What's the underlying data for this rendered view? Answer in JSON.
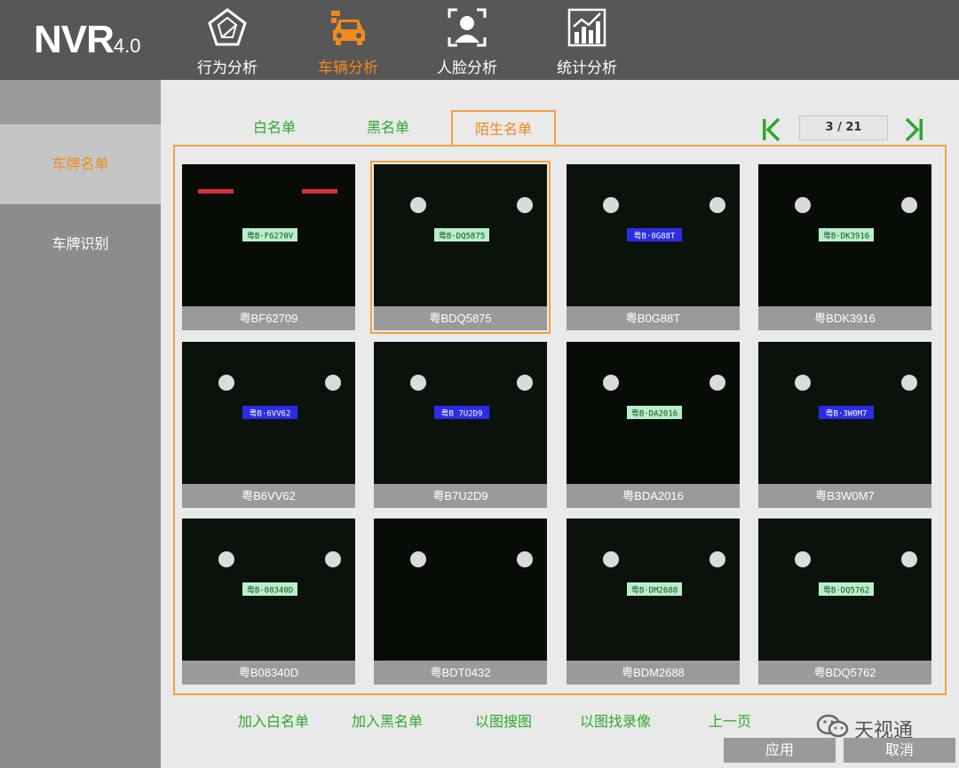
{
  "app": {
    "name": "NVR",
    "version": "4.0"
  },
  "nav": [
    {
      "label": "行为分析",
      "icon": "pentagon-analysis-icon",
      "active": false
    },
    {
      "label": "车辆分析",
      "icon": "car-icon",
      "active": true
    },
    {
      "label": "人脸分析",
      "icon": "face-scan-icon",
      "active": false
    },
    {
      "label": "统计分析",
      "icon": "bar-chart-icon",
      "active": false
    }
  ],
  "sidebar": [
    {
      "label": "车牌名单",
      "active": true
    },
    {
      "label": "车牌识别",
      "active": false
    }
  ],
  "tabs": [
    {
      "label": "白名单",
      "active": false
    },
    {
      "label": "黑名单",
      "active": false
    },
    {
      "label": "陌生名单",
      "active": true
    }
  ],
  "pagination": {
    "indicator": "3 / 21",
    "prev_icon": "first-page-icon",
    "next_icon": "last-page-icon"
  },
  "plates": [
    {
      "caption": "粤BF62709",
      "plate_text": "粤B·F6270V",
      "plate_color": "green",
      "selected": false
    },
    {
      "caption": "粤BDQ5875",
      "plate_text": "粤B·DQ5875",
      "plate_color": "green",
      "selected": true
    },
    {
      "caption": "粤B0G88T",
      "plate_text": "粤B·0G88T",
      "plate_color": "blue",
      "selected": false
    },
    {
      "caption": "粤BDK3916",
      "plate_text": "粤B·DK3916",
      "plate_color": "green",
      "selected": false
    },
    {
      "caption": "粤B6VV62",
      "plate_text": "粤B·6VV62",
      "plate_color": "blue",
      "selected": false
    },
    {
      "caption": "粤B7U2D9",
      "plate_text": "粤B 7U2D9",
      "plate_color": "blue",
      "selected": false
    },
    {
      "caption": "粤BDA2016",
      "plate_text": "粤B·DA2016",
      "plate_color": "green",
      "selected": false
    },
    {
      "caption": "粤B3W0M7",
      "plate_text": "粤B·3W0M7",
      "plate_color": "blue",
      "selected": false
    },
    {
      "caption": "粤B08340D",
      "plate_text": "粤B·08340D",
      "plate_color": "green",
      "selected": false
    },
    {
      "caption": "粤BDT0432",
      "plate_text": "",
      "plate_color": "none",
      "selected": false
    },
    {
      "caption": "粤BDM2688",
      "plate_text": "粤B·DM2688",
      "plate_color": "green",
      "selected": false
    },
    {
      "caption": "粤BDQ5762",
      "plate_text": "粤B·DQ5762",
      "plate_color": "green",
      "selected": false
    }
  ],
  "actions": [
    {
      "label": "加入白名单"
    },
    {
      "label": "加入黑名单"
    },
    {
      "label": "以图搜图"
    },
    {
      "label": "以图找录像"
    },
    {
      "label": "上一页"
    }
  ],
  "watermark": {
    "text": "天视通",
    "icon": "wechat-icon"
  },
  "buttons": {
    "apply": "应用",
    "cancel": "取消"
  },
  "colors": {
    "accent": "#f08a1c",
    "link_green": "#2ea82e",
    "topbar": "#575757",
    "sidebar": "#8c8c8c"
  }
}
